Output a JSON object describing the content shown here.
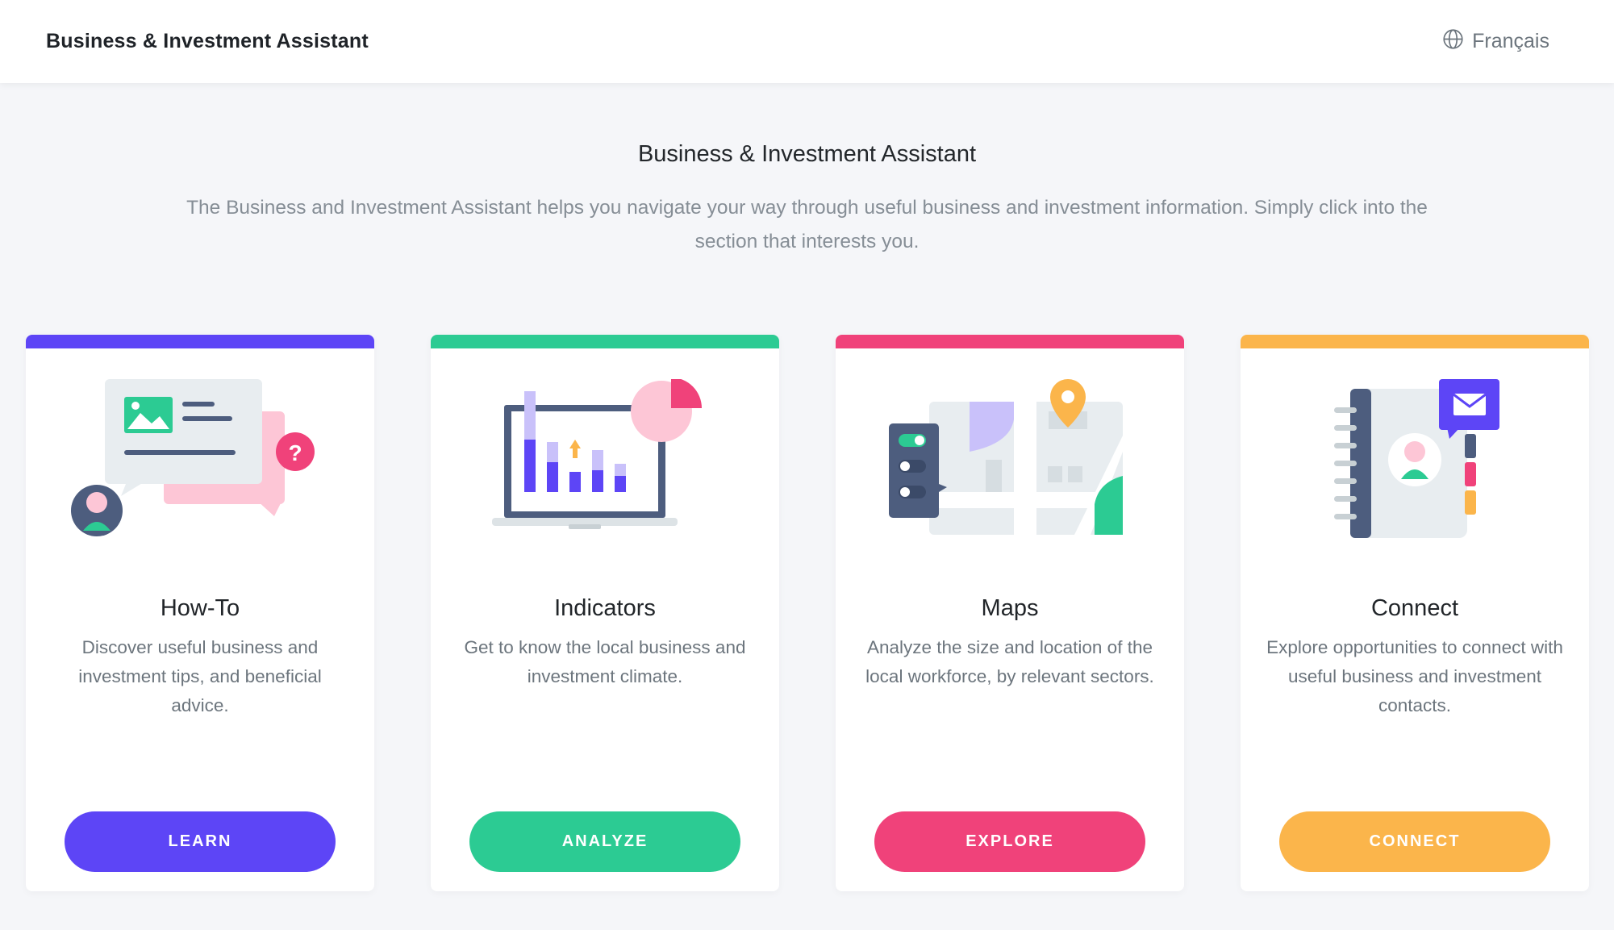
{
  "header": {
    "title": "Business & Investment Assistant",
    "language_label": "Français",
    "language_icon": "globe-icon"
  },
  "intro": {
    "title": "Business & Investment Assistant",
    "description": "The Business and Investment Assistant helps you navigate your way through useful business and investment information. Simply click into the section that interests you."
  },
  "cards": [
    {
      "title": "How-To",
      "description": "Discover useful business and investment tips, and beneficial advice.",
      "button": "LEARN",
      "color": "#5d45f6",
      "icon": "help-chat-illustration"
    },
    {
      "title": "Indicators",
      "description": "Get to know the local business and investment climate.",
      "button": "ANALYZE",
      "color": "#2ccb93",
      "icon": "chart-laptop-illustration"
    },
    {
      "title": "Maps",
      "description": "Analyze the size and location of the local workforce, by relevant sectors.",
      "button": "EXPLORE",
      "color": "#f0427a",
      "icon": "map-pin-illustration"
    },
    {
      "title": "Connect",
      "description": "Explore opportunities to connect with useful business and investment contacts.",
      "button": "CONNECT",
      "color": "#fbb54b",
      "icon": "contact-book-illustration"
    }
  ]
}
